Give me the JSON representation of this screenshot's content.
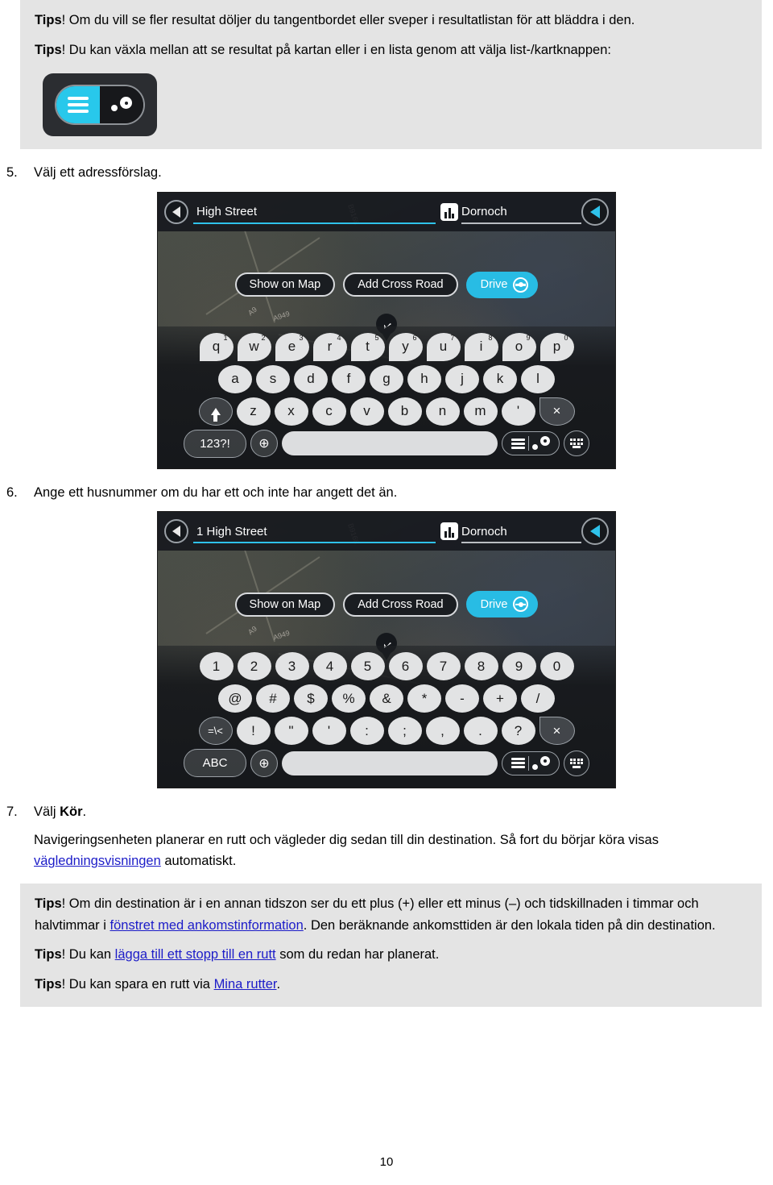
{
  "document": {
    "page_number": "10",
    "language": "sv"
  },
  "tips_top": {
    "items": [
      {
        "lead": "Tips",
        "text": "! Om du vill se fler resultat döljer du tangentbordet eller sveper i resultatlistan för att bläddra i den."
      },
      {
        "lead": "Tips",
        "text": "! Du kan växla mellan att se resultat på kartan eller i en lista genom att välja list-/kartknappen:"
      }
    ],
    "toggle_button_name": "list-map-toggle-button"
  },
  "steps": {
    "step5": {
      "num": "5.",
      "text": "Välj ett adressförslag."
    },
    "step6": {
      "num": "6.",
      "text": "Ange ett husnummer om du har ett och inte har angett det än."
    },
    "step7": {
      "num": "7.",
      "prefix": "Välj ",
      "bold": "Kör",
      "suffix": "."
    }
  },
  "step7_body": {
    "part1": "Navigeringsenheten planerar en rutt och vägleder dig sedan till din destination. Så fort du börjar köra visas ",
    "link": "vägledningsvisningen",
    "part2": " automatiskt."
  },
  "tips_bottom": {
    "item1": {
      "lead": "Tips",
      "part1": "! Om din destination är i en annan tidszon ser du ett plus (+) eller ett minus (–) och tidskillnaden i timmar och halvtimmar i ",
      "link": "fönstret med ankomstinformation",
      "part2": ". Den beräknande ankomsttiden är den lokala tiden på din destination."
    },
    "item2": {
      "lead": "Tips",
      "part1": "! Du kan ",
      "link": "lägga till ett stopp till en rutt",
      "part2": " som du redan har planerat."
    },
    "item3": {
      "lead": "Tips",
      "part1": "! Du kan spara en rutt via ",
      "link": "Mina rutter",
      "part2": "."
    }
  },
  "device_address": {
    "street_field_value": "High Street",
    "city_field_value": "Dornoch",
    "buttons": {
      "show_on_map": "Show on Map",
      "add_cross_road": "Add Cross Road",
      "drive": "Drive"
    },
    "map_labels": {
      "road1": "A9",
      "road2": "A949",
      "road3": "B9168"
    },
    "keyboard": {
      "row1": [
        {
          "k": "q",
          "s": "1"
        },
        {
          "k": "w",
          "s": "2"
        },
        {
          "k": "e",
          "s": "3"
        },
        {
          "k": "r",
          "s": "4"
        },
        {
          "k": "t",
          "s": "5"
        },
        {
          "k": "y",
          "s": "6"
        },
        {
          "k": "u",
          "s": "7"
        },
        {
          "k": "i",
          "s": "8"
        },
        {
          "k": "o",
          "s": "9"
        },
        {
          "k": "p",
          "s": "0"
        }
      ],
      "row2": [
        "a",
        "s",
        "d",
        "f",
        "g",
        "h",
        "j",
        "k",
        "l"
      ],
      "row3": [
        "z",
        "x",
        "c",
        "v",
        "b",
        "n",
        "m",
        "'"
      ],
      "mode_key": "123?!",
      "shift_key": "shift-key",
      "backspace_key": "×",
      "globe_key": "⊕"
    }
  },
  "device_housenumber": {
    "street_field_value": "1 High Street",
    "city_field_value": "Dornoch",
    "buttons": {
      "show_on_map": "Show on Map",
      "add_cross_road": "Add Cross Road",
      "drive": "Drive"
    },
    "map_labels": {
      "road1": "A9",
      "road2": "A949",
      "road3": "B9168"
    },
    "keyboard": {
      "row1": [
        "1",
        "2",
        "3",
        "4",
        "5",
        "6",
        "7",
        "8",
        "9",
        "0"
      ],
      "row2": [
        "@",
        "#",
        "$",
        "%",
        "&",
        "*",
        "-",
        "+",
        "/"
      ],
      "row3": [
        "!",
        "\"",
        "'",
        ":",
        ";",
        ",",
        ".",
        "?"
      ],
      "mode_key": "ABC",
      "symbol_key": "=\\<",
      "backspace_key": "×",
      "globe_key": "⊕"
    }
  },
  "colors": {
    "accent_cyan": "#28bce4",
    "link_blue": "#1c1cc8",
    "tips_bg": "#e4e4e4",
    "device_dark": "#16181b"
  }
}
